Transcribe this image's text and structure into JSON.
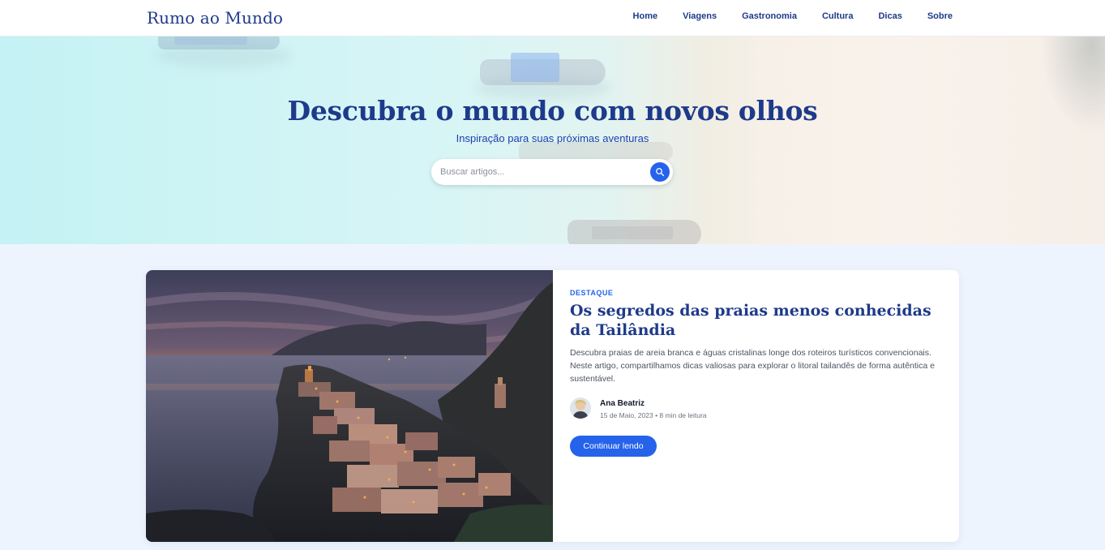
{
  "header": {
    "logo": "Rumo ao Mundo",
    "nav": [
      "Home",
      "Viagens",
      "Gastronomia",
      "Cultura",
      "Dicas",
      "Sobre"
    ]
  },
  "hero": {
    "title": "Descubra o mundo com novos olhos",
    "subtitle": "Inspiração para suas próximas aventuras",
    "search": {
      "placeholder": "Buscar artigos...",
      "button_icon": "search-icon"
    }
  },
  "featured": {
    "tag": "DESTAQUE",
    "title": "Os segredos das praias menos conhecidas da Tailândia",
    "excerpt": "Descubra praias de areia branca e águas cristalinas longe dos roteiros turísticos convencionais. Neste artigo, compartilhamos dicas valiosas para explorar o litoral tailandês de forma autêntica e sustentável.",
    "author": {
      "name": "Ana Beatriz",
      "date": "15 de Maio, 2023",
      "read_time": "8 min de leitura"
    },
    "cta": "Continuar lendo"
  },
  "colors": {
    "primary": "#2563eb",
    "heading": "#1e3a8a",
    "page_bg": "#eef4fd"
  }
}
